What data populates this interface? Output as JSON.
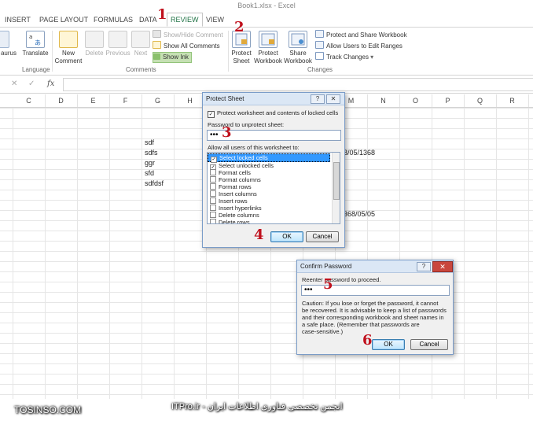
{
  "window": {
    "title": "Book1.xlsx - Excel"
  },
  "tabs": [
    "INSERT",
    "PAGE LAYOUT",
    "FORMULAS",
    "DATA",
    "REVIEW",
    "VIEW"
  ],
  "ribbon": {
    "thesaurus": "aurus",
    "translate": "Translate",
    "language_group": "Language",
    "new_comment": [
      "New",
      "Comment"
    ],
    "delete": "Delete",
    "previous": "Previous",
    "next": "Next",
    "show_hide_comment": "Show/Hide Comment",
    "show_all_comments": "Show All Comments",
    "show_ink": "Show Ink",
    "comments_group": "Comments",
    "protect_sheet": [
      "Protect",
      "Sheet"
    ],
    "protect_workbook": [
      "Protect",
      "Workbook"
    ],
    "share_workbook": [
      "Share",
      "Workbook"
    ],
    "protect_and_share": "Protect and Share Workbook",
    "allow_users": "Allow Users to Edit Ranges",
    "track_changes": "Track Changes",
    "changes_group": "Changes"
  },
  "formula_bar": {
    "cancel": "✕",
    "enter": "✓",
    "fx": "fx",
    "value": ""
  },
  "columns": [
    "C",
    "D",
    "E",
    "F",
    "G",
    "H",
    "I",
    "J",
    "K",
    "L",
    "M",
    "N",
    "O",
    "P",
    "Q",
    "R"
  ],
  "cells": {
    "g1": "sdf",
    "g2": "sdfs",
    "g3": "ggr",
    "g4": "sfd",
    "g5": "sdfdsf",
    "date1": "8/05/1368",
    "date2": "368/05/05"
  },
  "protect_dialog": {
    "title": "Protect Sheet",
    "help": "?",
    "close": "✕",
    "protect_checkbox": "Protect worksheet and contents of locked cells",
    "password_label": "Password to unprotect sheet:",
    "password_value": "•••",
    "allow_label": "Allow all users of this worksheet to:",
    "options": [
      {
        "label": "Select locked cells",
        "checked": true
      },
      {
        "label": "Select unlocked cells",
        "checked": true
      },
      {
        "label": "Format cells",
        "checked": false
      },
      {
        "label": "Format columns",
        "checked": false
      },
      {
        "label": "Format rows",
        "checked": false
      },
      {
        "label": "Insert columns",
        "checked": false
      },
      {
        "label": "Insert rows",
        "checked": false
      },
      {
        "label": "Insert hyperlinks",
        "checked": false
      },
      {
        "label": "Delete columns",
        "checked": false
      },
      {
        "label": "Delete rows",
        "checked": false
      }
    ],
    "ok": "OK",
    "cancel": "Cancel"
  },
  "confirm_dialog": {
    "title": "Confirm Password",
    "help": "?",
    "close": "✕",
    "reenter_label": "Reenter password to proceed.",
    "password_value": "•••",
    "caution": [
      "Caution: If you lose or forget the password, it cannot",
      "be recovered. It is advisable to keep a list of passwords",
      "and their corresponding workbook and sheet names in",
      "a safe place.  (Remember that passwords are",
      "case-sensitive.)"
    ],
    "ok": "OK",
    "cancel": "Cancel"
  },
  "callouts": [
    "1",
    "2",
    "3",
    "4",
    "5",
    "6"
  ],
  "watermarks": {
    "left": "TOSINSO.COM",
    "right": "ITPro.ir - انجمن تخصصی فناوری اطلاعات ایران"
  },
  "colors": {
    "excel_green": "#217346",
    "callout_red": "#c0111d",
    "selection_blue": "#3399ff"
  }
}
